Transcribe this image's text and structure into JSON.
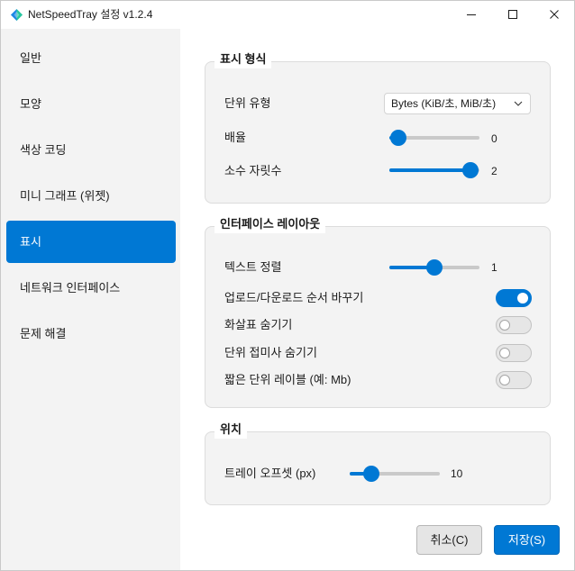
{
  "window": {
    "title": "NetSpeedTray 설정 v1.2.4"
  },
  "sidebar": {
    "items": [
      {
        "label": "일반",
        "selected": false
      },
      {
        "label": "모양",
        "selected": false
      },
      {
        "label": "색상 코딩",
        "selected": false
      },
      {
        "label": "미니 그래프 (위젯)",
        "selected": false
      },
      {
        "label": "표시",
        "selected": true
      },
      {
        "label": "네트워크 인터페이스",
        "selected": false
      },
      {
        "label": "문제 해결",
        "selected": false
      }
    ]
  },
  "display_format": {
    "title": "표시 형식",
    "unit_type": {
      "label": "단위 유형",
      "value": "Bytes (KiB/초, MiB/초)"
    },
    "scale": {
      "label": "배율",
      "value": "0",
      "level": 0
    },
    "decimal_places": {
      "label": "소수 자릿수",
      "value": "2",
      "level": 1
    }
  },
  "interface_layout": {
    "title": "인터페이스 레이아웃",
    "text_alignment": {
      "label": "텍스트 정렬",
      "value": "1",
      "level": 0.5
    },
    "swap_upload_download": {
      "label": "업로드/다운로드 순서 바꾸기",
      "on": true
    },
    "hide_arrows": {
      "label": "화살표 숨기기",
      "on": false
    },
    "hide_unit_suffix": {
      "label": "단위 접미사 숨기기",
      "on": false
    },
    "short_unit_labels": {
      "label": "짧은 단위 레이블 (예: Mb)",
      "on": false
    }
  },
  "position": {
    "title": "위치",
    "tray_offset": {
      "label": "트레이 오프셋 (px)",
      "value": "10",
      "level": 0.18
    }
  },
  "footer": {
    "cancel_label": "취소(C)",
    "save_label": "저장(S)"
  },
  "icons": {
    "app": "app-icon",
    "minimize": "minimize-icon",
    "maximize": "maximize-icon",
    "close": "close-icon",
    "unit_type_dropdown": "chevron-down-icon"
  },
  "colors": {
    "accent": "#0078d4",
    "sidebar_background": "#f3f3f3",
    "content_background": "#ffffff",
    "group_background": "#f3f3f3"
  }
}
